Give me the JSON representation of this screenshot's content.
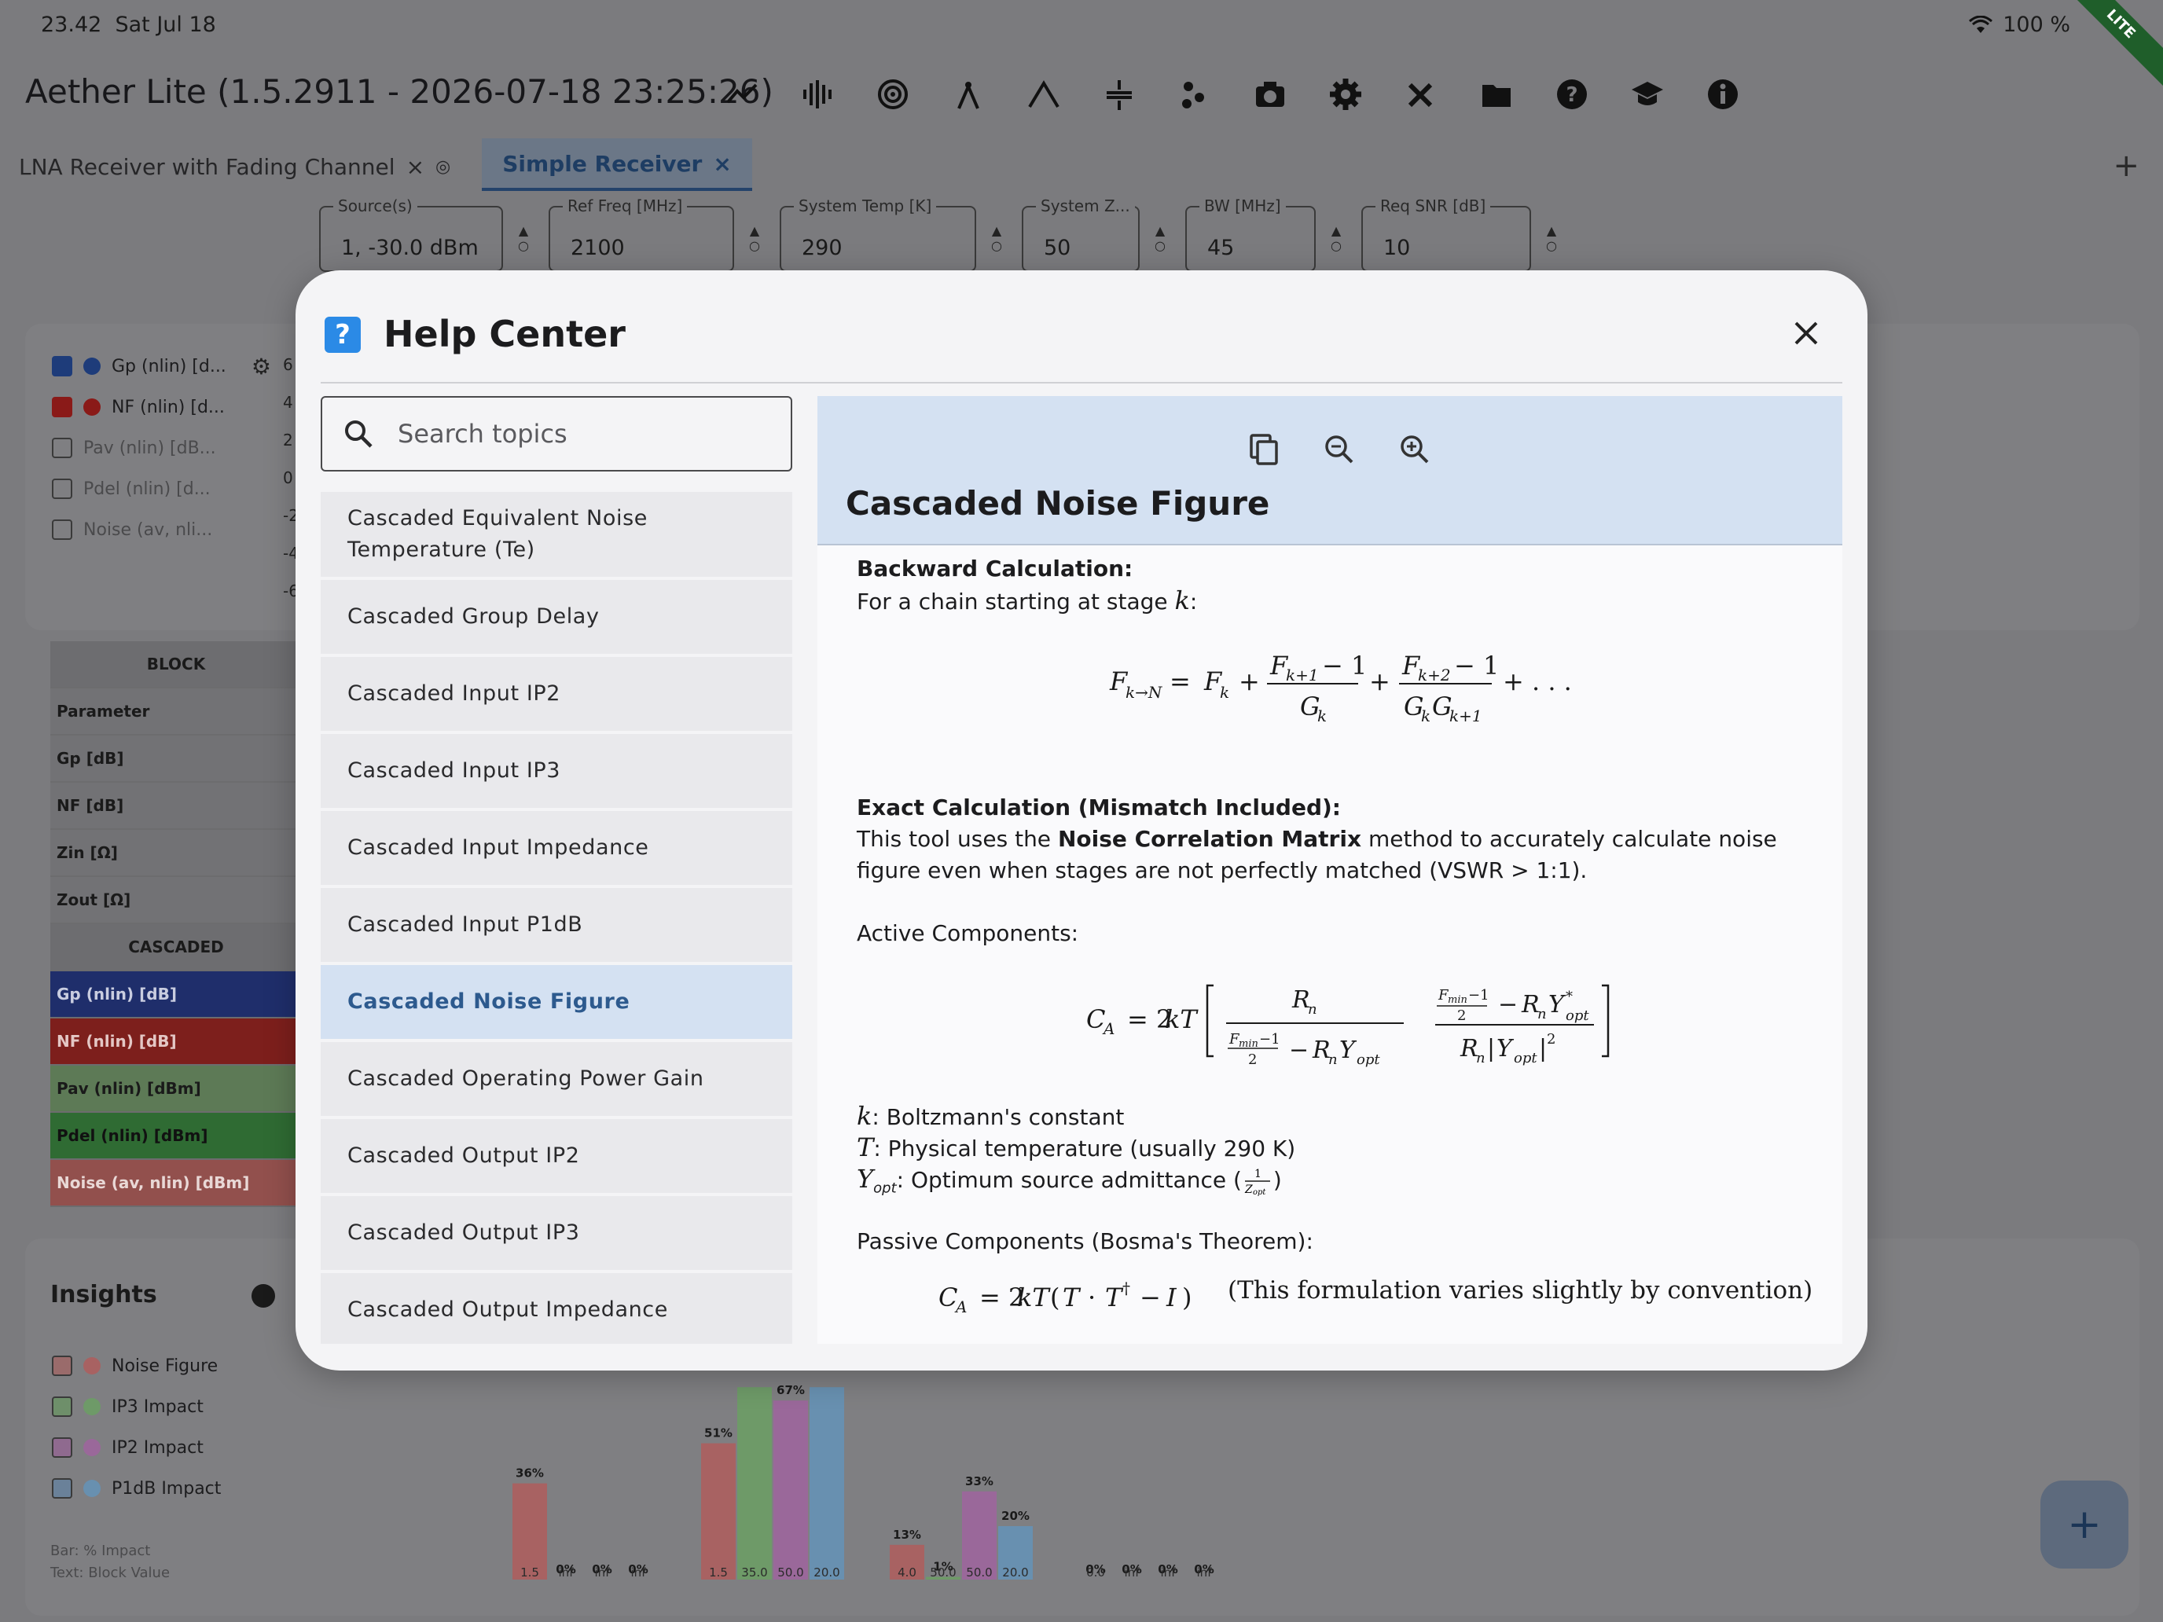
{
  "status_bar": {
    "time": "23.42",
    "date": "Sat Jul 18",
    "battery": "100 %",
    "ribbon": "LITE"
  },
  "app": {
    "title": "Aether Lite (1.5.2911 - 2026-07-18 23:25:26)"
  },
  "toolbar_icons": [
    "line-chart-icon",
    "waveform-icon",
    "target-icon",
    "compass-icon",
    "bell-curve-icon",
    "spacing-icon",
    "scatter-icon",
    "camera-icon",
    "gear-icon",
    "tools-icon",
    "folder-icon",
    "help-icon",
    "school-icon",
    "info-icon"
  ],
  "tabs": [
    {
      "label": "LNA Receiver with Fading Channel",
      "active": false
    },
    {
      "label": "Simple Receiver",
      "active": true
    }
  ],
  "params": [
    {
      "label": "Source(s)",
      "value": "1, -30.0 dBm"
    },
    {
      "label": "Ref Freq [MHz]",
      "value": "2100"
    },
    {
      "label": "System Temp [K]",
      "value": "290"
    },
    {
      "label": "System Z...",
      "value": "50"
    },
    {
      "label": "BW [MHz]",
      "value": "45"
    },
    {
      "label": "Req SNR [dB]",
      "value": "10"
    }
  ],
  "plot_legend": [
    {
      "label": "Gp (nlin) [d...",
      "checked": true,
      "color": "#1e3c7a"
    },
    {
      "label": "NF (nlin) [d...",
      "checked": true,
      "color": "#8a1a18"
    },
    {
      "label": "Pav (nlin) [dB...",
      "checked": false,
      "color": ""
    },
    {
      "label": "Pdel (nlin) [d...",
      "checked": false,
      "color": ""
    },
    {
      "label": "Noise (av, nli...",
      "checked": false,
      "color": ""
    }
  ],
  "plot_axis": [
    "6",
    "4",
    "2",
    "0",
    "-2",
    "-4",
    "-6"
  ],
  "block_table": {
    "block_header": "BLOCK",
    "parameter_label": "Parameter",
    "rows": [
      "Gp [dB]",
      "NF [dB]",
      "Zin [Ω]",
      "Zout [Ω]"
    ],
    "cascaded_header": "CASCADED",
    "cascaded_rows": [
      "Gp (nlin) [dB]",
      "NF (nlin) [dB]",
      "Pav (nlin) [dBm]",
      "Pdel (nlin) [dBm]",
      "Noise (av, nlin) [dBm]"
    ]
  },
  "insights": {
    "title": "Insights",
    "legend": [
      {
        "label": "Noise Figure",
        "color": "#c86a6a"
      },
      {
        "label": "IP3 Impact",
        "color": "#7fb07a"
      },
      {
        "label": "IP2 Impact",
        "color": "#b07ab0"
      },
      {
        "label": "P1dB Impact",
        "color": "#7aa5c8"
      }
    ],
    "note_line1": "Bar: % Impact",
    "note_line2": "Text: Block Value"
  },
  "chart_data": {
    "type": "bar",
    "groups": [
      {
        "bars": [
          {
            "series": "Noise Figure",
            "pct": "36%",
            "value": "1.5",
            "h": 36
          },
          {
            "series": "IP3 Impact",
            "pct": "0%",
            "value": "inf",
            "h": 0
          },
          {
            "series": "IP2 Impact",
            "pct": "0%",
            "value": "inf",
            "h": 0
          },
          {
            "series": "P1dB Impact",
            "pct": "0%",
            "value": "inf",
            "h": 0
          }
        ]
      },
      {
        "bars": [
          {
            "series": "Noise Figure",
            "pct": "51%",
            "value": "1.5",
            "h": 51
          },
          {
            "series": "IP3 Impact",
            "pct": "",
            "value": "35.0",
            "h": 72
          },
          {
            "series": "IP2 Impact",
            "pct": "67%",
            "value": "50.0",
            "h": 67
          },
          {
            "series": "P1dB Impact",
            "pct": "",
            "value": "20.0",
            "h": 72
          }
        ]
      },
      {
        "bars": [
          {
            "series": "Noise Figure",
            "pct": "13%",
            "value": "4.0",
            "h": 13
          },
          {
            "series": "IP3 Impact",
            "pct": "1%",
            "value": "50.0",
            "h": 1
          },
          {
            "series": "IP2 Impact",
            "pct": "33%",
            "value": "50.0",
            "h": 33
          },
          {
            "series": "P1dB Impact",
            "pct": "20%",
            "value": "20.0",
            "h": 20
          }
        ]
      },
      {
        "bars": [
          {
            "series": "Noise Figure",
            "pct": "0%",
            "value": "0.0",
            "h": 0
          },
          {
            "series": "IP3 Impact",
            "pct": "0%",
            "value": "inf",
            "h": 0
          },
          {
            "series": "IP2 Impact",
            "pct": "0%",
            "value": "inf",
            "h": 0
          },
          {
            "series": "P1dB Impact",
            "pct": "0%",
            "value": "inf",
            "h": 0
          }
        ]
      }
    ]
  },
  "help_center": {
    "title": "Help Center",
    "search_placeholder": "Search topics",
    "topics": [
      "Cascaded Equivalent Noise Temperature (Te)",
      "Cascaded Group Delay",
      "Cascaded Input IP2",
      "Cascaded Input IP3",
      "Cascaded Input Impedance",
      "Cascaded Input P1dB",
      "Cascaded Noise Figure",
      "Cascaded Operating Power Gain",
      "Cascaded Output IP2",
      "Cascaded Output IP3",
      "Cascaded Output Impedance"
    ],
    "selected_topic": "Cascaded Noise Figure",
    "article": {
      "title": "Cascaded Noise Figure",
      "backward_heading": "Backward Calculation:",
      "backward_text": "For a chain starting at stage",
      "backward_var": "k",
      "exact_heading": "Exact Calculation (Mismatch Included):",
      "exact_pre": "This tool uses the",
      "exact_bold": "Noise Correlation Matrix",
      "exact_post": "method to accurately calculate noise figure even when stages are not perfectly matched (VSWR > 1:1).",
      "active_heading": "Active Components:",
      "def_k_sym": "k",
      "def_k": ": Boltzmann's constant",
      "def_T_sym": "T",
      "def_T": ": Physical temperature (usually 290 K)",
      "def_Y_sym": "Y",
      "def_Y_sub": "opt",
      "def_Y": ": Optimum source admittance (",
      "def_Y_end": ")",
      "passive_heading": "Passive Components (Bosma's Theorem):",
      "passive_note": "(This formulation varies slightly by convention)"
    }
  }
}
